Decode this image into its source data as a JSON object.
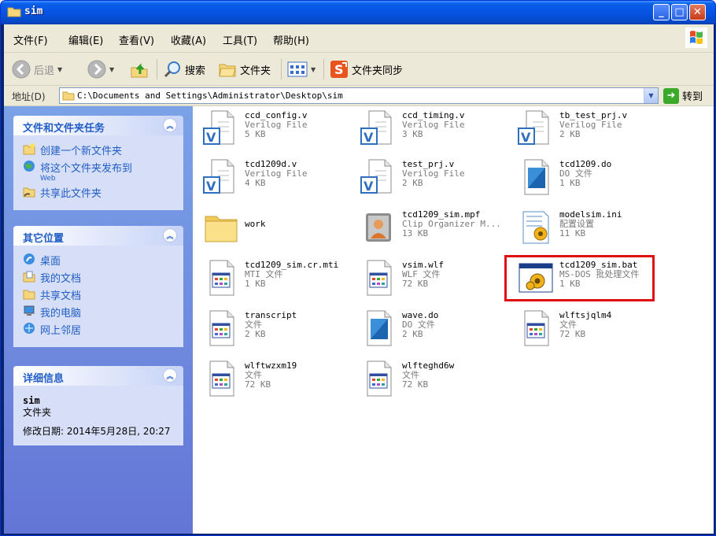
{
  "window": {
    "title": "sim"
  },
  "menu": [
    "文件(F)",
    "编辑(E)",
    "查看(V)",
    "收藏(A)",
    "工具(T)",
    "帮助(H)"
  ],
  "toolbar": {
    "back": "后退",
    "search": "搜索",
    "folders": "文件夹",
    "sync": "文件夹同步"
  },
  "address": {
    "label": "地址(D)",
    "path": "C:\\Documents and Settings\\Administrator\\Desktop\\sim",
    "go": "转到"
  },
  "tasks": {
    "file_tasks": {
      "title": "文件和文件夹任务",
      "items": [
        {
          "label": "创建一个新文件夹",
          "icon": "new-folder-icon"
        },
        {
          "label": "将这个文件夹发布到",
          "sub": "Web",
          "icon": "publish-web-icon"
        },
        {
          "label": "共享此文件夹",
          "icon": "share-folder-icon"
        }
      ]
    },
    "other_places": {
      "title": "其它位置",
      "items": [
        {
          "label": "桌面",
          "icon": "desktop-icon"
        },
        {
          "label": "我的文档",
          "icon": "my-documents-icon"
        },
        {
          "label": "共享文档",
          "icon": "shared-documents-icon"
        },
        {
          "label": "我的电脑",
          "icon": "my-computer-icon"
        },
        {
          "label": "网上邻居",
          "icon": "network-icon"
        }
      ]
    },
    "details": {
      "title": "详细信息",
      "name": "sim",
      "type": "文件夹",
      "modified": "修改日期: 2014年5月28日, 20:27"
    }
  },
  "files": [
    {
      "name": "ccd_config.v",
      "type": "Verilog File",
      "size": "5 KB",
      "icon": "verilog-file-icon"
    },
    {
      "name": "ccd_timing.v",
      "type": "Verilog File",
      "size": "3 KB",
      "icon": "verilog-file-icon"
    },
    {
      "name": "tb_test_prj.v",
      "type": "Verilog File",
      "size": "2 KB",
      "icon": "verilog-file-icon"
    },
    {
      "name": "tcd1209d.v",
      "type": "Verilog File",
      "size": "4 KB",
      "icon": "verilog-file-icon"
    },
    {
      "name": "test_prj.v",
      "type": "Verilog File",
      "size": "2 KB",
      "icon": "verilog-file-icon"
    },
    {
      "name": "tcd1209.do",
      "type": "DO 文件",
      "size": "1 KB",
      "icon": "do-file-icon"
    },
    {
      "name": "work",
      "type": "",
      "size": "",
      "icon": "folder-icon"
    },
    {
      "name": "tcd1209_sim.mpf",
      "type": "Clip Organizer M...",
      "size": "13 KB",
      "icon": "clip-organizer-icon"
    },
    {
      "name": "modelsim.ini",
      "type": "配置设置",
      "size": "11 KB",
      "icon": "config-file-icon"
    },
    {
      "name": "tcd1209_sim.cr.mti",
      "type": "MTI 文件",
      "size": "1 KB",
      "icon": "generic-file-icon"
    },
    {
      "name": "vsim.wlf",
      "type": "WLF 文件",
      "size": "72 KB",
      "icon": "generic-file-icon"
    },
    {
      "name": "tcd1209_sim.bat",
      "type": "MS-DOS 批处理文件",
      "size": "1 KB",
      "icon": "batch-file-icon"
    },
    {
      "name": "transcript",
      "type": "文件",
      "size": "2 KB",
      "icon": "generic-file-icon"
    },
    {
      "name": "wave.do",
      "type": "DO 文件",
      "size": "2 KB",
      "icon": "do-file-icon"
    },
    {
      "name": "wlftsjqlm4",
      "type": "文件",
      "size": "72 KB",
      "icon": "generic-file-icon"
    },
    {
      "name": "wlftwzxm19",
      "type": "文件",
      "size": "72 KB",
      "icon": "generic-file-icon"
    },
    {
      "name": "wlfteghd6w",
      "type": "文件",
      "size": "72 KB",
      "icon": "generic-file-icon"
    }
  ]
}
